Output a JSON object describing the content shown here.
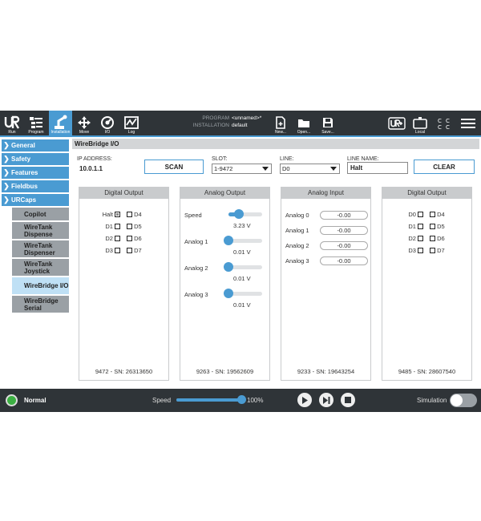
{
  "topbar": {
    "run_label": "Run",
    "program_label": "Program",
    "installation_label": "Installation",
    "move_label": "Move",
    "io_label": "I/O",
    "log_label": "Log",
    "program_key": "PROGRAM",
    "program_value": "<unnamed>*",
    "installation_key": "INSTALLATION",
    "installation_value": "default",
    "new_label": "New...",
    "open_label": "Open...",
    "save_label": "Save...",
    "local_label": "Local"
  },
  "sidebar": {
    "items": [
      {
        "label": "General"
      },
      {
        "label": "Safety"
      },
      {
        "label": "Features"
      },
      {
        "label": "Fieldbus"
      },
      {
        "label": "URCaps"
      }
    ],
    "urcaps": [
      {
        "label": "Copilot"
      },
      {
        "label": "WireTank Dispense"
      },
      {
        "label": "WireTank Dispenser"
      },
      {
        "label": "WireTank Joystick"
      },
      {
        "label": "WireBridge I/O"
      },
      {
        "label": "WireBridge Serial"
      }
    ]
  },
  "content": {
    "title": "WireBridge I/O",
    "ip_label": "IP ADDRESS:",
    "ip_value": "10.0.1.1",
    "scan_label": "SCAN",
    "slot_label": "SLOT:",
    "slot_value": "1-9472",
    "line_label": "LINE:",
    "line_value": "D0",
    "line_name_label": "LINE NAME:",
    "line_name_value": "Halt",
    "clear_label": "CLEAR"
  },
  "panels": {
    "p1": {
      "title": "Digital Output",
      "rows": [
        [
          "Halt",
          "D4"
        ],
        [
          "D1",
          "D5"
        ],
        [
          "D2",
          "D6"
        ],
        [
          "D3",
          "D7"
        ]
      ],
      "sn": "9472 - SN: 26313650"
    },
    "p2": {
      "title": "Analog Output",
      "channels": [
        {
          "label": "Speed",
          "value": "3.23 V",
          "level": 0.3
        },
        {
          "label": "Analog 1",
          "value": "0.01 V",
          "level": 0.0
        },
        {
          "label": "Analog 2",
          "value": "0.01 V",
          "level": 0.0
        },
        {
          "label": "Analog 3",
          "value": "0.01 V",
          "level": 0.0
        }
      ],
      "sn": "9263 - SN: 19562609"
    },
    "p3": {
      "title": "Analog Input",
      "channels": [
        {
          "label": "Analog 0",
          "value": "-0.00"
        },
        {
          "label": "Analog 1",
          "value": "-0.00"
        },
        {
          "label": "Analog 2",
          "value": "-0.00"
        },
        {
          "label": "Analog 3",
          "value": "-0.00"
        }
      ],
      "sn": "9233 - SN: 19643254"
    },
    "p4": {
      "title": "Digital Output",
      "rows": [
        [
          "D0",
          "D4"
        ],
        [
          "D1",
          "D5"
        ],
        [
          "D2",
          "D6"
        ],
        [
          "D3",
          "D7"
        ]
      ],
      "sn": "9485 - SN: 28607540"
    }
  },
  "bottombar": {
    "status": "Normal",
    "speed_label": "Speed",
    "speed_value": "100%",
    "speed_level": 1.0,
    "simulation_label": "Simulation"
  },
  "colors": {
    "accent": "#4a9bd2",
    "bar": "#2f3438",
    "status_ok": "#3cb043"
  }
}
